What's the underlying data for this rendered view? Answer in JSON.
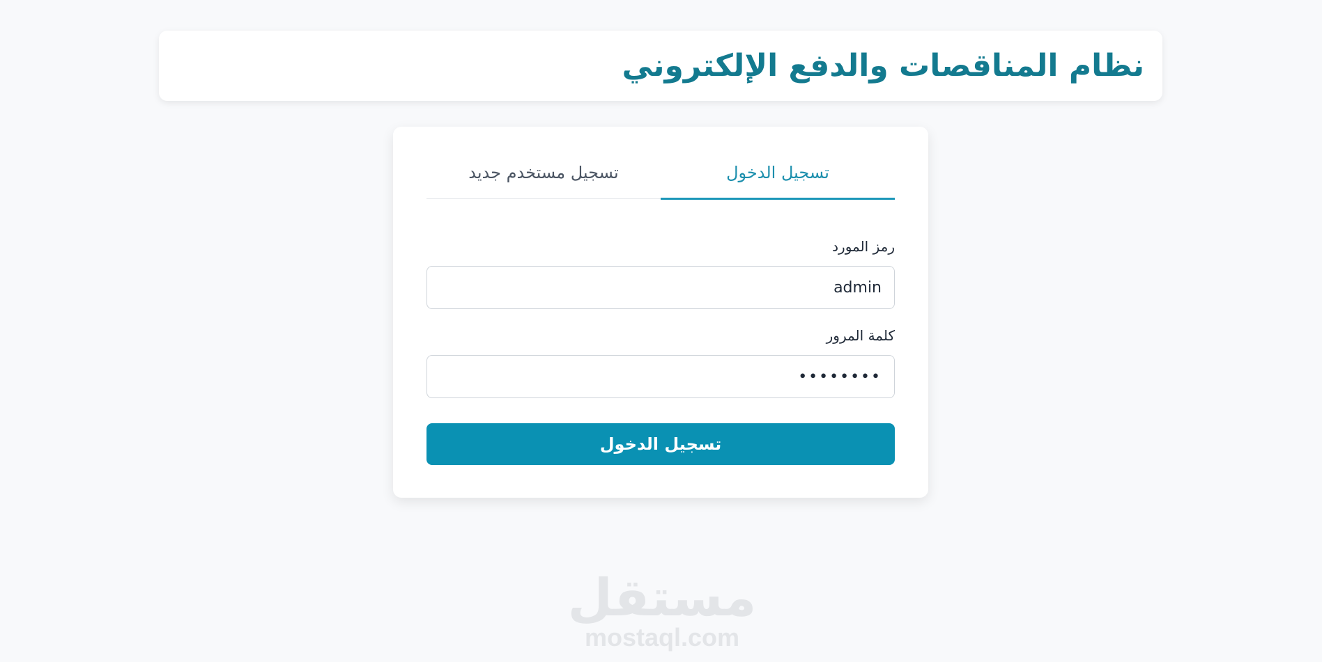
{
  "header": {
    "title": "نظام المناقصات والدفع الإلكتروني"
  },
  "tabs": [
    {
      "label": "تسجيل الدخول",
      "active": true
    },
    {
      "label": "تسجيل مستخدم جديد",
      "active": false
    }
  ],
  "form": {
    "supplier_code_label": "رمز المورد",
    "supplier_code_value": "admin",
    "password_label": "كلمة المرور",
    "password_value": "........",
    "submit_label": "تسجيل الدخول"
  },
  "watermark": {
    "arabic": "مستقل",
    "latin": "mostaql.com"
  },
  "colors": {
    "brand": "#137a8f",
    "accent": "#0a91b3",
    "background": "#f8f9fb"
  }
}
